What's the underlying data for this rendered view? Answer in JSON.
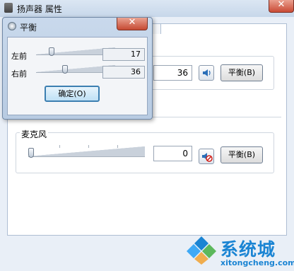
{
  "window": {
    "title": "扬声器 属性"
  },
  "balance_dialog": {
    "title": "平衡",
    "channels": [
      {
        "label": "左前",
        "value": "17",
        "level": 0.17
      },
      {
        "label": "右前",
        "value": "36",
        "level": 0.36
      }
    ],
    "ok_label": "确定(O)"
  },
  "speaker_level": {
    "value": "36",
    "balance_label": "平衡(B)"
  },
  "microphone": {
    "label": "麦克风",
    "value": "0",
    "level": 0,
    "muted": true,
    "balance_label": "平衡(B)"
  },
  "watermark": {
    "name": "系统城",
    "domain": "xitongcheng.com"
  },
  "colors": {
    "accent": "#1a84d3",
    "mute_red": "#d0201a"
  }
}
